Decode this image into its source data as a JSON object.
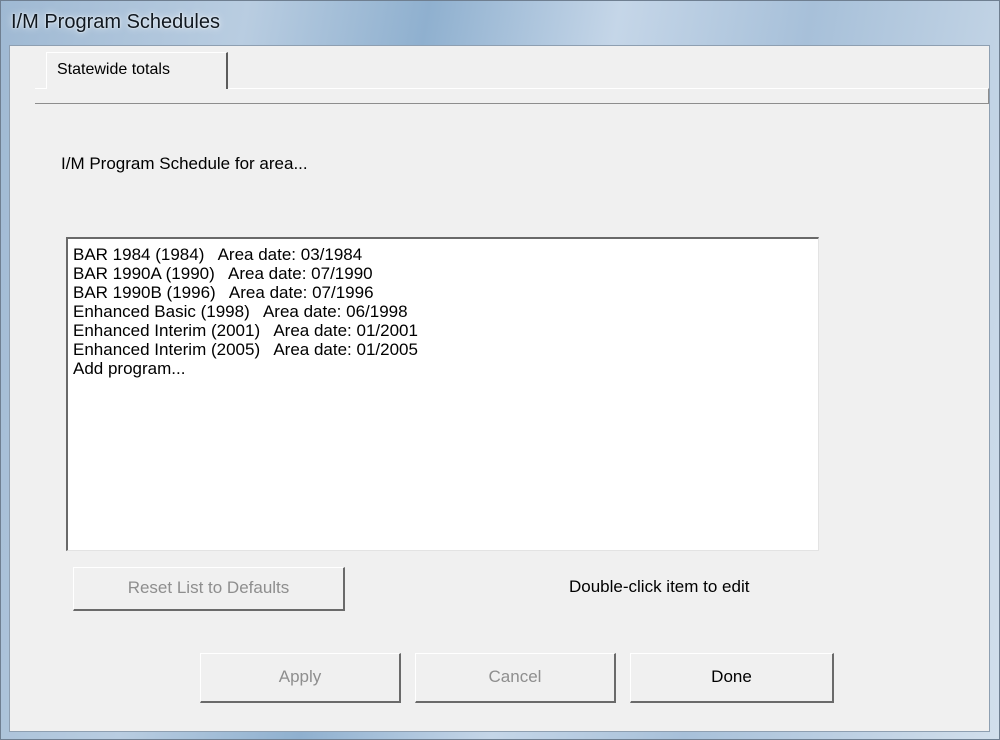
{
  "window": {
    "title": "I/M Program Schedules"
  },
  "tabs": [
    {
      "label": "Statewide totals"
    }
  ],
  "schedule": {
    "label": "I/M Program Schedule for area...",
    "items": [
      "BAR 1984 (1984)   Area date: 03/1984",
      "BAR 1990A (1990)   Area date: 07/1990",
      "BAR 1990B (1996)   Area date: 07/1996",
      "Enhanced Basic (1998)   Area date: 06/1998",
      "Enhanced Interim (2001)   Area date: 01/2001",
      "Enhanced Interim (2005)   Area date: 01/2005",
      "Add program..."
    ]
  },
  "controls": {
    "reset_label": "Reset List to Defaults",
    "hint": "Double-click item to edit"
  },
  "footer": {
    "apply_label": "Apply",
    "cancel_label": "Cancel",
    "done_label": "Done"
  },
  "colors": {
    "disabled_text": "#8e8e8e",
    "face": "#f0f0f0"
  }
}
